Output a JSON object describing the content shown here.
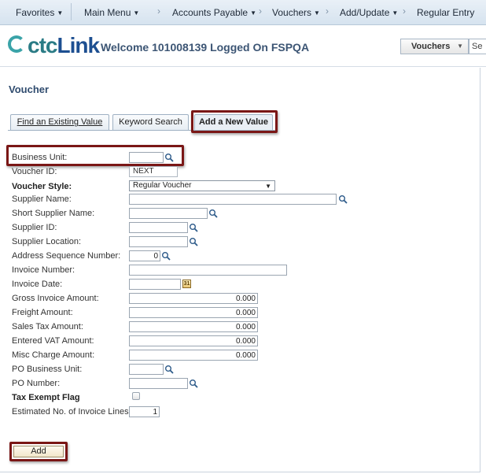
{
  "nav": {
    "favorites": "Favorites",
    "main_menu": "Main Menu",
    "accounts_payable": "Accounts Payable",
    "vouchers": "Vouchers",
    "add_update": "Add/Update",
    "regular_entry": "Regular Entry"
  },
  "header": {
    "logo_prefix": "ctc",
    "logo_suffix": "Link",
    "welcome": "Welcome 101008139 Logged On FSPQA",
    "search_scope": "Vouchers",
    "search_stub": "Se"
  },
  "page": {
    "title": "Voucher",
    "tabs": [
      "Find an Existing Value",
      "Keyword Search",
      "Add a New Value"
    ]
  },
  "form": {
    "business_unit_label": "Business Unit:",
    "business_unit_value": "",
    "voucher_id_label": "Voucher ID:",
    "voucher_id_value": "NEXT",
    "voucher_style_label": "Voucher Style:",
    "voucher_style_value": "Regular Voucher",
    "supplier_name_label": "Supplier Name:",
    "short_supplier_name_label": "Short Supplier Name:",
    "supplier_id_label": "Supplier ID:",
    "supplier_location_label": "Supplier Location:",
    "address_sequence_label": "Address Sequence Number:",
    "address_sequence_value": "0",
    "invoice_number_label": "Invoice Number:",
    "invoice_date_label": "Invoice Date:",
    "gross_invoice_label": "Gross Invoice Amount:",
    "gross_invoice_value": "0.000",
    "freight_label": "Freight Amount:",
    "freight_value": "0.000",
    "sales_tax_label": "Sales Tax Amount:",
    "sales_tax_value": "0.000",
    "entered_vat_label": "Entered VAT Amount:",
    "entered_vat_value": "0.000",
    "misc_charge_label": "Misc Charge Amount:",
    "misc_charge_value": "0.000",
    "po_business_unit_label": "PO Business Unit:",
    "po_number_label": "PO Number:",
    "tax_exempt_label": "Tax Exempt Flag",
    "tax_exempt_checked": false,
    "est_lines_label": "Estimated No. of Invoice Lines:",
    "est_lines_value": "1"
  },
  "actions": {
    "add_label": "Add"
  },
  "icons": {
    "lookup": "magnifier-icon",
    "calendar": "calendar-icon",
    "calendar_glyph": "31"
  },
  "colors": {
    "highlight": "#7a1716",
    "title": "#2f4b6e"
  }
}
